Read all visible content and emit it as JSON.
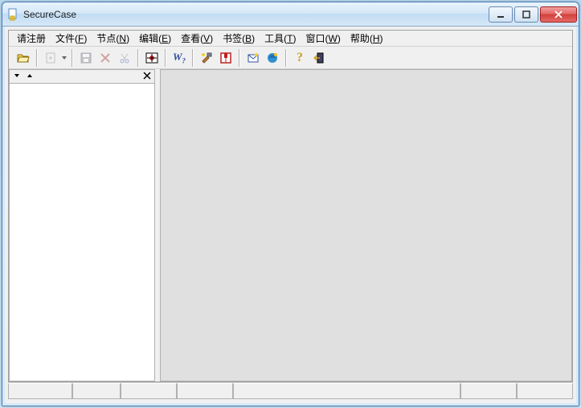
{
  "window": {
    "title": "SecureCase"
  },
  "menu": {
    "register": {
      "label": "请注册"
    },
    "file": {
      "label": "文件",
      "mn": "F"
    },
    "node": {
      "label": "节点",
      "mn": "N"
    },
    "edit": {
      "label": "编辑",
      "mn": "E"
    },
    "view": {
      "label": "查看",
      "mn": "V"
    },
    "bookmark": {
      "label": "书签",
      "mn": "B"
    },
    "tools": {
      "label": "工具",
      "mn": "T"
    },
    "window": {
      "label": "窗口",
      "mn": "W"
    },
    "help": {
      "label": "帮助",
      "mn": "H"
    }
  },
  "toolbar": {
    "open_label": "open",
    "new_label": "new",
    "save_label": "save",
    "delete_label": "delete",
    "cut_label": "cut",
    "target_label": "target",
    "w_label": "W",
    "wp": "?",
    "tool_label": "tool",
    "book_label": "book",
    "mail_label": "mail",
    "ie_label": "ie",
    "help_label": "help",
    "exit_label": "exit"
  }
}
